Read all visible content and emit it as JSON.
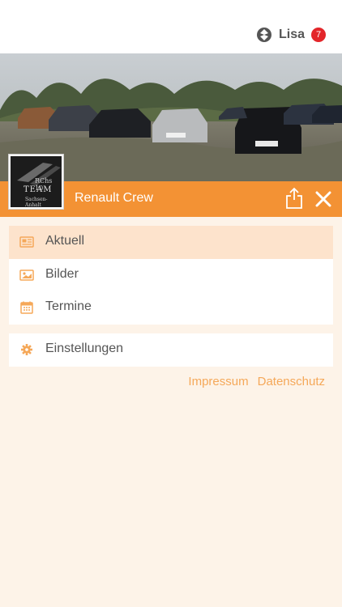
{
  "user": {
    "name": "Lisa",
    "badge_count": "7"
  },
  "group": {
    "title": "Renault Crew"
  },
  "logo": {
    "line1": "RChs 10",
    "line2": "TEAM",
    "line3": "Sachsen-\nAnhalt"
  },
  "menu": {
    "items": [
      {
        "label": "Aktuell",
        "icon": "newspaper-icon",
        "active": true
      },
      {
        "label": "Bilder",
        "icon": "image-icon",
        "active": false
      },
      {
        "label": "Termine",
        "icon": "calendar-icon",
        "active": false
      }
    ],
    "settings": {
      "label": "Einstellungen",
      "icon": "gear-icon"
    }
  },
  "footer": {
    "impressum": "Impressum",
    "datenschutz": "Datenschutz"
  },
  "colors": {
    "accent": "#f39234",
    "background": "#fdf3e8",
    "active_row": "#fde3cc",
    "link": "#f5a859",
    "badge": "#e3262a"
  }
}
